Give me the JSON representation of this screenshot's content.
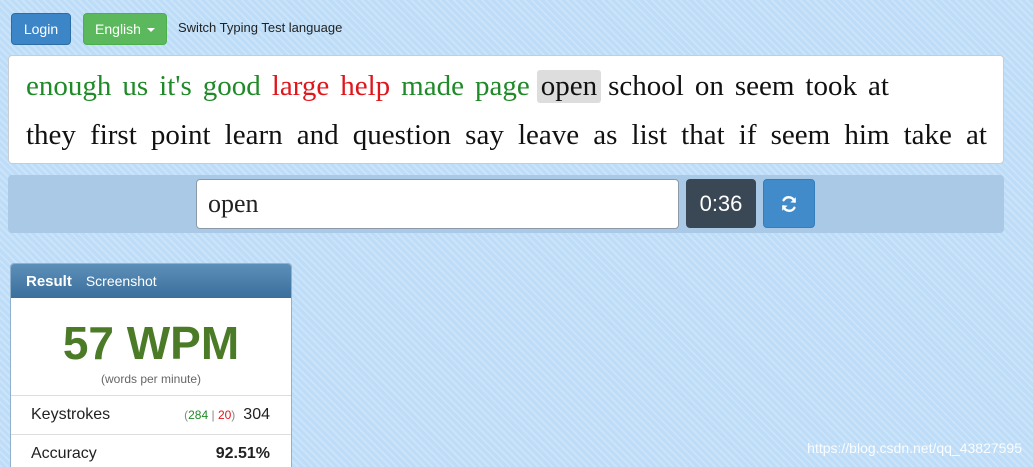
{
  "topbar": {
    "login_label": "Login",
    "language_label": "English",
    "hint": "Switch Typing Test language"
  },
  "words": {
    "line1": [
      {
        "text": "enough",
        "state": "correct"
      },
      {
        "text": "us",
        "state": "correct"
      },
      {
        "text": "it's",
        "state": "correct"
      },
      {
        "text": "good",
        "state": "correct"
      },
      {
        "text": "large",
        "state": "wrong"
      },
      {
        "text": "help",
        "state": "wrong"
      },
      {
        "text": "made",
        "state": "correct"
      },
      {
        "text": "page",
        "state": "correct"
      },
      {
        "text": "open",
        "state": "current"
      },
      {
        "text": "school",
        "state": "pending"
      },
      {
        "text": "on",
        "state": "pending"
      },
      {
        "text": "seem",
        "state": "pending"
      },
      {
        "text": "took",
        "state": "pending"
      },
      {
        "text": "at",
        "state": "pending"
      }
    ],
    "line2": [
      "they",
      "first",
      "point",
      "learn",
      "and",
      "question",
      "say",
      "leave",
      "as",
      "list",
      "that",
      "if",
      "seem",
      "him",
      "take",
      "at"
    ]
  },
  "input": {
    "value": "open",
    "timer": "0:36"
  },
  "result": {
    "title": "Result",
    "tab": "Screenshot",
    "wpm": "57 WPM",
    "wpm_sub": "(words per minute)",
    "keystrokes_label": "Keystrokes",
    "keystrokes_correct": "284",
    "keystrokes_sep": "|",
    "keystrokes_wrong": "20",
    "keystrokes_total": "304",
    "accuracy_label": "Accuracy",
    "accuracy_value": "92.51%"
  },
  "watermark": "https://blog.csdn.net/qq_43827595",
  "colors": {
    "correct": "#1f8a28",
    "wrong": "#e0161d",
    "accent": "#428bca",
    "wpm": "#4b7b26"
  }
}
